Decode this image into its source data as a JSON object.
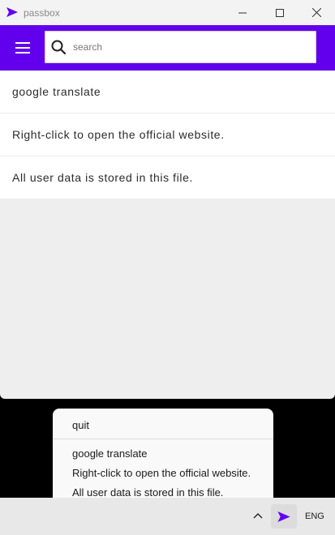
{
  "window": {
    "title": "passbox"
  },
  "search": {
    "placeholder": "search",
    "value": ""
  },
  "entries": [
    {
      "label": "google translate"
    },
    {
      "label": "Right-click to open the official website."
    },
    {
      "label": "All user data is stored in this file."
    }
  ],
  "tray_menu": {
    "quit_label": "quit",
    "items": [
      {
        "label": "google translate"
      },
      {
        "label": "Right-click to open the official website."
      },
      {
        "label": "All user data is stored in this file."
      }
    ]
  },
  "taskbar": {
    "language": "ENG"
  },
  "colors": {
    "accent": "#6200ee",
    "list_bg": "#ffffff",
    "window_bg": "#eeeeee"
  },
  "icons": {
    "app": "paper-plane-icon",
    "menu": "hamburger-icon",
    "search": "search-icon",
    "minimize": "minimize-icon",
    "maximize": "maximize-icon",
    "close": "close-icon",
    "tray_chevron": "chevron-up-icon"
  }
}
